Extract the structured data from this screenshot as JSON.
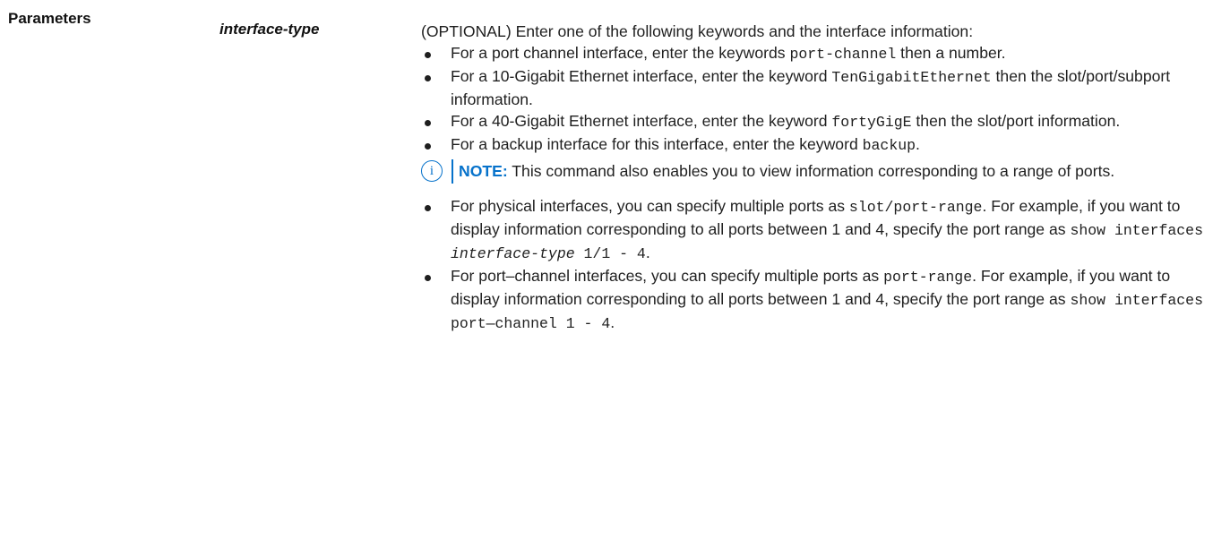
{
  "section": "Parameters",
  "param": "interface-type",
  "intro": "(OPTIONAL) Enter one of the following keywords and the interface information:",
  "items": [
    {
      "pre": "For a port channel interface, enter the keywords ",
      "code": "port-channel",
      "post": " then a number."
    },
    {
      "pre": "For a 10-Gigabit Ethernet interface, enter the keyword ",
      "code": "TenGigabitEthernet",
      "post": " then the slot/port/subport information."
    },
    {
      "pre": "For a 40-Gigabit Ethernet interface, enter the keyword ",
      "code": "fortyGigE",
      "post": " then the slot/port information."
    },
    {
      "pre": "For a backup interface for this interface, enter the keyword ",
      "code": "backup",
      "post": "."
    }
  ],
  "note": {
    "label": "NOTE:",
    "text": " This command also enables you to view information corresponding to a range of ports."
  },
  "items2": [
    {
      "pre": "For physical interfaces, you can specify multiple ports as ",
      "code1": "slot/port-range",
      "mid": ". For example, if you want to display information corresponding to all ports between 1 and 4, specify the port range as ",
      "code2": "show interfaces ",
      "code3": "interface-type",
      "code4": " 1/1 - 4",
      "post": "."
    },
    {
      "pre": "For port–channel interfaces, you can specify multiple ports as ",
      "code1": "port-range",
      "mid": ". For example, if you want to display information corresponding to all ports between 1 and 4, specify the port range as ",
      "code2": "show interfaces port—channel 1 - 4",
      "post": "."
    }
  ]
}
